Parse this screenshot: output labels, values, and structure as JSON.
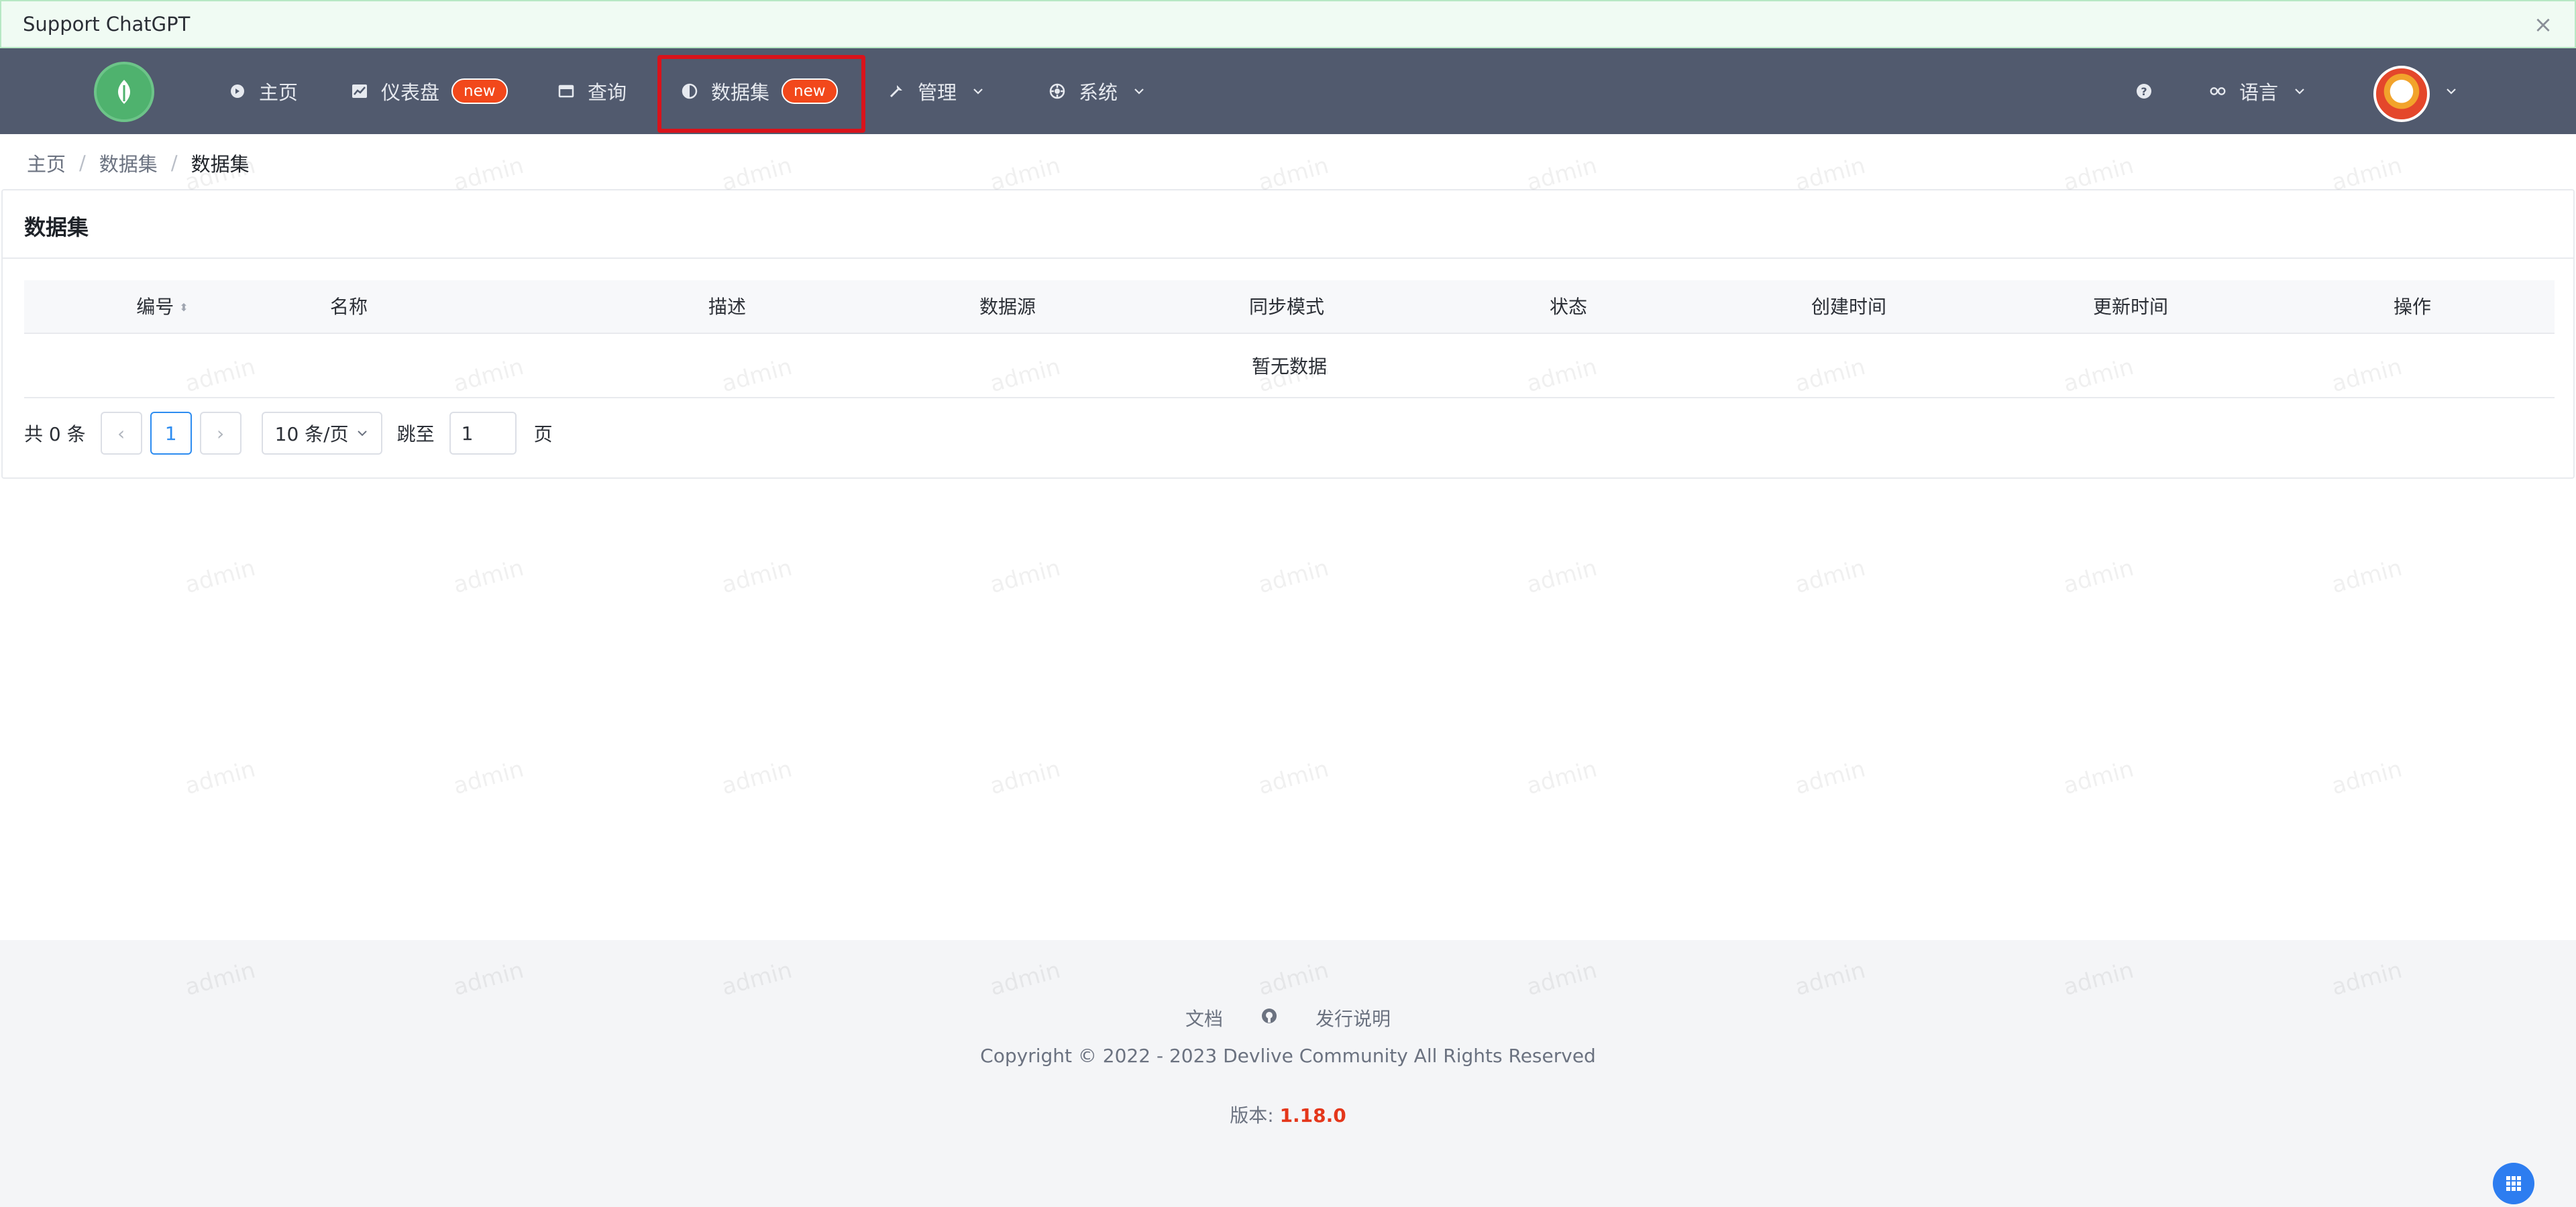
{
  "alert": {
    "text": "Support ChatGPT",
    "close_label": "×"
  },
  "nav": {
    "items": [
      {
        "label": "主页",
        "icon": "home-icon"
      },
      {
        "label": "仪表盘",
        "icon": "dashboard-icon",
        "badge": "new"
      },
      {
        "label": "查询",
        "icon": "query-icon"
      },
      {
        "label": "数据集",
        "icon": "dataset-icon",
        "badge": "new"
      },
      {
        "label": "管理",
        "icon": "manage-icon"
      },
      {
        "label": "系统",
        "icon": "system-icon"
      }
    ],
    "help_icon": "help-icon",
    "language_label": "语言",
    "colors": {
      "bar": "#515a6e",
      "badge": "#f2481b",
      "highlight": "#d9131b"
    }
  },
  "breadcrumb": {
    "items": [
      "主页",
      "数据集",
      "数据集"
    ]
  },
  "card": {
    "title": "数据集",
    "columns": [
      "编号",
      "名称",
      "描述",
      "数据源",
      "同步模式",
      "状态",
      "创建时间",
      "更新时间",
      "操作"
    ],
    "empty_text": "暂无数据",
    "pagination": {
      "total_label": "共 0 条",
      "prev": "‹",
      "current_page": "1",
      "next": "›",
      "page_size": "10 条/页",
      "jump_label": "跳至",
      "jump_value": "1",
      "page_suffix": "页"
    }
  },
  "watermark": "admin",
  "footer": {
    "docs": "文档",
    "release_notes": "发行说明",
    "copyright": "Copyright © 2022 - 2023 Devlive Community All Rights Reserved",
    "version_label": "版本: ",
    "version": "1.18.0"
  }
}
